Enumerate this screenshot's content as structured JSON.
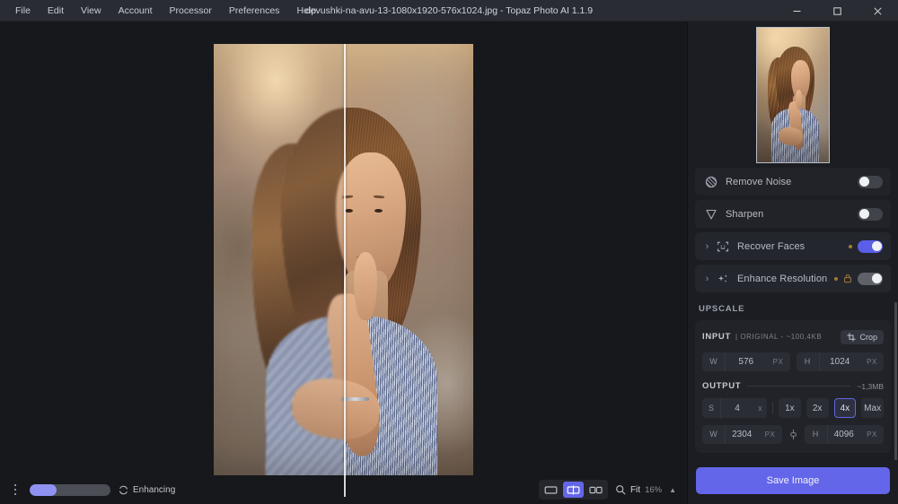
{
  "window": {
    "title": "devushki-na-avu-13-1080x1920-576x1024.jpg - Topaz Photo AI 1.1.9",
    "minimize_label": "–",
    "maximize_label": "□",
    "close_label": "✕"
  },
  "menu": {
    "items": [
      {
        "label": "File"
      },
      {
        "label": "Edit"
      },
      {
        "label": "View"
      },
      {
        "label": "Account"
      },
      {
        "label": "Processor"
      },
      {
        "label": "Preferences"
      },
      {
        "label": "Help"
      }
    ]
  },
  "filters": [
    {
      "label": "Remove Noise",
      "icon": "noise-circle-icon",
      "enabled": false,
      "expandable": false,
      "has_dot": false,
      "has_lock": false,
      "toggle_state": "off"
    },
    {
      "label": "Sharpen",
      "icon": "sharpen-funnel-icon",
      "enabled": false,
      "expandable": false,
      "has_dot": false,
      "has_lock": false,
      "toggle_state": "off"
    },
    {
      "label": "Recover Faces",
      "icon": "face-frame-icon",
      "enabled": true,
      "expandable": true,
      "has_dot": true,
      "has_lock": false,
      "toggle_state": "on"
    },
    {
      "label": "Enhance Resolution",
      "icon": "sparkles-icon",
      "enabled": true,
      "expandable": true,
      "has_dot": true,
      "has_lock": true,
      "toggle_state": "on-muted"
    }
  ],
  "upscale": {
    "section_label": "UPSCALE",
    "input": {
      "label": "INPUT",
      "meta": "| ORIGINAL - ~100,4KB",
      "crop_label": "Crop",
      "crop_icon": "crop-icon",
      "width_key": "W",
      "width_value": "576",
      "width_unit": "PX",
      "height_key": "H",
      "height_value": "1024",
      "height_unit": "PX"
    },
    "output": {
      "label": "OUTPUT",
      "size": "~1,3MB",
      "scale_key": "S",
      "scale_value": "4",
      "scale_unit": "x",
      "multipliers": [
        {
          "label": "1x",
          "selected": false
        },
        {
          "label": "2x",
          "selected": false
        },
        {
          "label": "4x",
          "selected": true
        },
        {
          "label": "Max",
          "selected": false
        }
      ],
      "width_key": "W",
      "width_value": "2304",
      "width_unit": "PX",
      "link_icon": "link-icon",
      "height_key": "H",
      "height_value": "4096",
      "height_unit": "PX"
    }
  },
  "save": {
    "label": "Save Image"
  },
  "statusbar": {
    "menu_icon": "more-vertical-icon",
    "progress_percent": 33,
    "spinner_icon": "loading-spinner-icon",
    "status_text": "Enhancing"
  },
  "viewcontrols": {
    "modes": [
      {
        "name": "single-view",
        "icon": "single-pane-icon",
        "selected": false
      },
      {
        "name": "split-view",
        "icon": "split-pane-icon",
        "selected": true
      },
      {
        "name": "side-by-side-view",
        "icon": "two-pane-icon",
        "selected": false
      }
    ],
    "zoom_icon": "magnifier-icon",
    "zoom_label": "Fit",
    "zoom_percent": "16%",
    "caret_icon": "chevron-up-icon"
  },
  "colors": {
    "accent": "#6366e8",
    "panel_bg": "#1b1d22",
    "app_bg": "#17181c",
    "titlebar_bg": "#2a2c33",
    "card_bg": "#212329",
    "warn_dot": "#a07a3c"
  }
}
